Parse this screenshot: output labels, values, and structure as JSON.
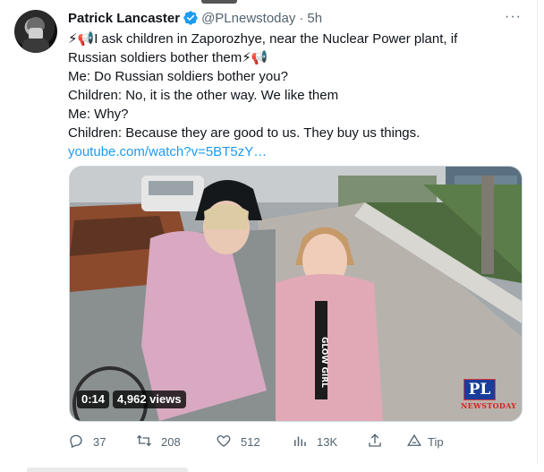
{
  "tweet": {
    "author_name": "Patrick Lancaster",
    "handle": "@PLnewstoday",
    "separator": "·",
    "time": "5h",
    "more_label": "···",
    "text_lines": [
      "⚡📢I ask children in Zaporozhye, near the Nuclear Power plant, if",
      "Russian soldiers bother them⚡📢",
      "Me: Do Russian soldiers bother you?",
      "Children: No, it is the other way. We like them",
      "Me: Why?",
      "Children: Because they are good to us. They buy us things."
    ],
    "link_text": "youtube.com/watch?v=5BT5zY…"
  },
  "video": {
    "duration": "0:14",
    "views": "4,962 views",
    "watermark_logo": "PL",
    "watermark_text": "NEWSTODAY",
    "jacket_text": "GLOW GIRL"
  },
  "actions": {
    "replies": "37",
    "retweets": "208",
    "likes": "512",
    "views": "13K",
    "tip": "Tip"
  },
  "colors": {
    "link": "#1d9bf0",
    "secondary_text": "#536471",
    "verified": "#1d9bf0"
  },
  "icons": {
    "verified": "verified-badge-icon",
    "more": "more-icon",
    "reply": "reply-icon",
    "retweet": "retweet-icon",
    "like": "heart-icon",
    "views": "views-icon",
    "share": "share-icon",
    "tip": "tip-icon"
  }
}
